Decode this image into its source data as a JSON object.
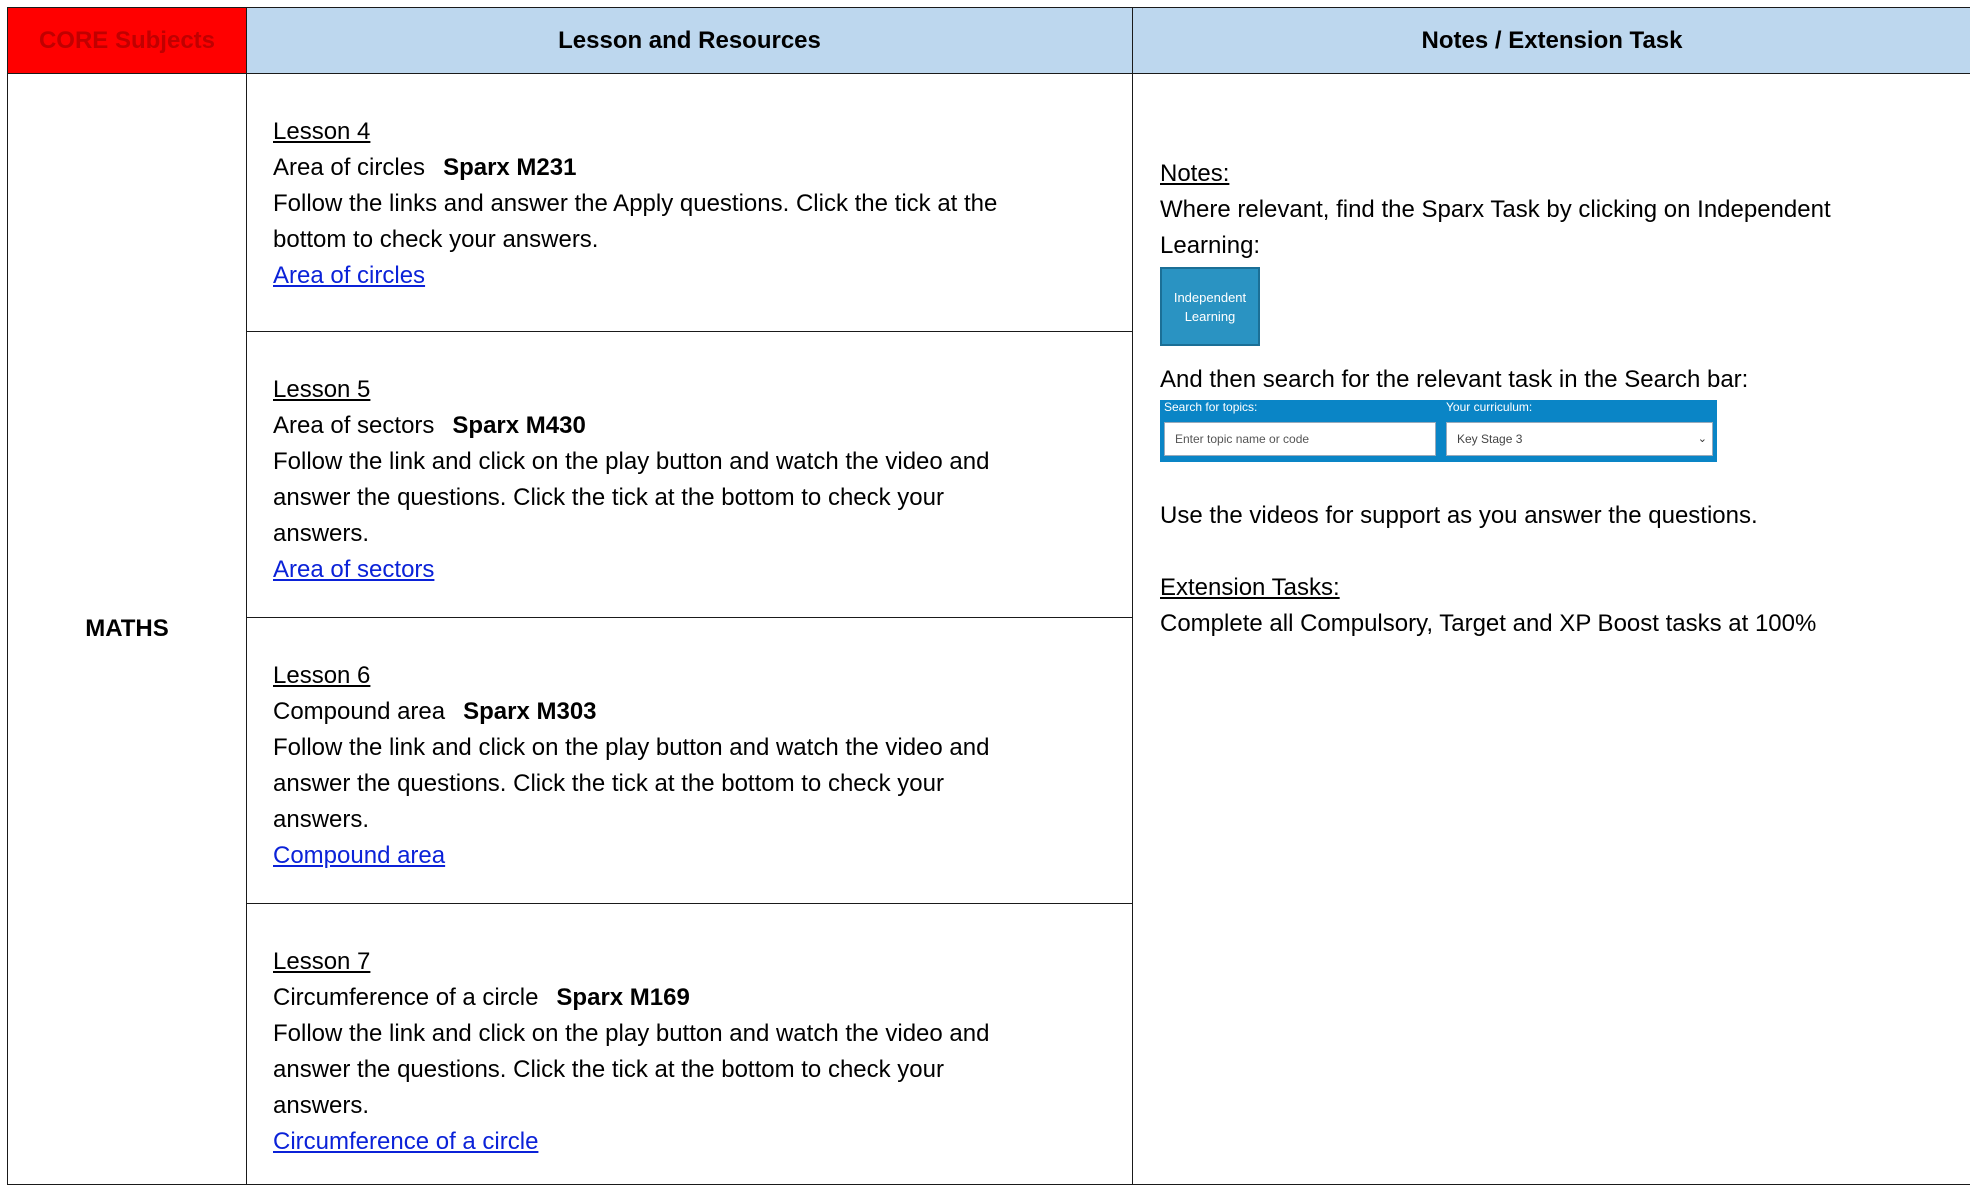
{
  "header": {
    "core": "CORE Subjects",
    "lesson": "Lesson and Resources",
    "notes": "Notes / Extension Task"
  },
  "subject": "MATHS",
  "lessons": [
    {
      "title": "Lesson 4",
      "topic": "Area of circles",
      "code": "Sparx M231",
      "lines": [
        "Follow the links and answer the Apply questions. Click the tick at the",
        "bottom to check your answers."
      ],
      "link": "Area of circles"
    },
    {
      "title": "Lesson 5",
      "topic": "Area of sectors",
      "code": "Sparx M430",
      "lines": [
        "Follow the link and click on the play button and watch the video and",
        "answer the questions. Click the tick at the bottom to check your",
        "answers."
      ],
      "link": "Area of sectors"
    },
    {
      "title": "Lesson 6",
      "topic": "Compound area",
      "code": "Sparx M303",
      "lines": [
        "Follow the link and click on the play button and watch the video and",
        "answer the questions. Click the tick at the bottom to check your",
        "answers."
      ],
      "link": "Compound area"
    },
    {
      "title": "Lesson 7",
      "topic": "Circumference of a circle",
      "code": "Sparx M169",
      "lines": [
        "Follow the link and click on the play button and watch the video and",
        "answer the questions. Click the tick at the bottom to check your",
        "answers."
      ],
      "link": "Circumference of a circle"
    }
  ],
  "notes": {
    "heading": "Notes: ",
    "line1": "Where relevant, find the Sparx Task by clicking on Independent",
    "line2": "Learning:",
    "tile_line1": "Independent",
    "tile_line2": "Learning",
    "search_intro": "And then search for the relevant task in the Search bar:",
    "search_label": "Search for topics:",
    "search_placeholder": "Enter topic name or code",
    "curriculum_label": "Your curriculum:",
    "curriculum_value": "Key Stage 3",
    "videos_line": "Use the videos for support as you answer the questions.",
    "extension_heading": "Extension Tasks:",
    "extension_line": "Complete all Compulsory, Target and XP Boost tasks at 100%"
  },
  "colors": {
    "core_header_bg": "#ff0000",
    "header_bg": "#bdd7ee",
    "link": "#0b22d8",
    "sparx_blue": "#0a85c6"
  }
}
